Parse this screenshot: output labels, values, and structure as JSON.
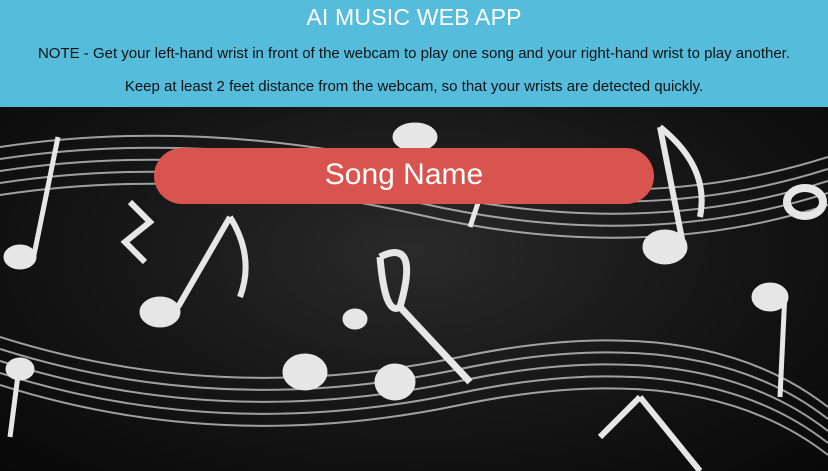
{
  "header": {
    "title": "AI MUSIC WEB APP",
    "note_line1": "NOTE - Get your left-hand wrist in front of the webcam to play one song and your right-hand wrist to play another.",
    "note_line2": "Keep at least 2 feet distance from the webcam, so that your wrists are detected quickly."
  },
  "player": {
    "song_name": "Song Name"
  },
  "colors": {
    "header_bg": "#56bcdc",
    "pill_bg": "#d9534f",
    "background": "#151515"
  },
  "background_image": "music-notes-chalkboard"
}
